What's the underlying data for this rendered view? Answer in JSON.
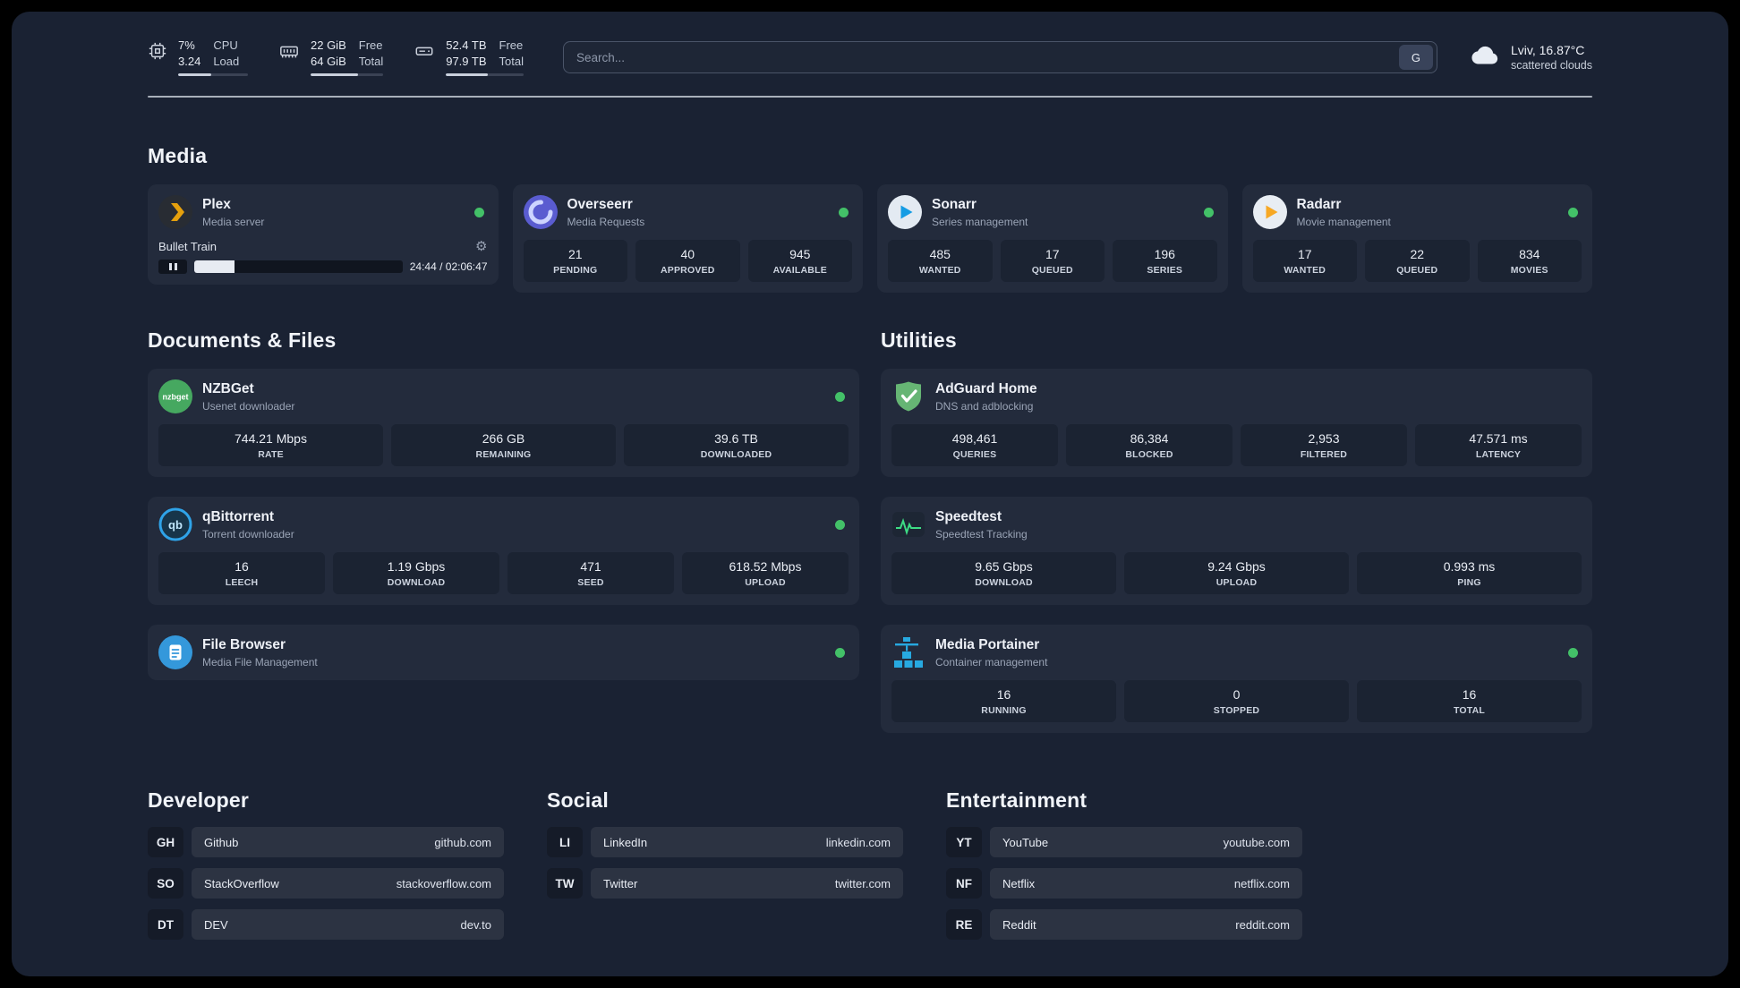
{
  "colors": {
    "background": "#1a2233",
    "card": "#232b3c",
    "stat_box": "#1b2332",
    "status_online": "#43c168",
    "plex_accent": "#e5a00d"
  },
  "topbar": {
    "cpu": {
      "icon": "cpu-icon",
      "value_top": "7%",
      "value_bottom": "3.24",
      "label_top": "CPU",
      "label_bottom": "Load",
      "bar_percent": 48
    },
    "ram": {
      "icon": "ram-icon",
      "value_top": "22 GiB",
      "value_bottom": "64 GiB",
      "label_top": "Free",
      "label_bottom": "Total",
      "bar_percent": 65
    },
    "disk": {
      "icon": "disk-icon",
      "value_top": "52.4 TB",
      "value_bottom": "97.9 TB",
      "label_top": "Free",
      "label_bottom": "Total",
      "bar_percent": 54
    },
    "search": {
      "placeholder": "Search...",
      "button_label": "G"
    },
    "weather": {
      "icon": "cloud-icon",
      "location": "Lviv, 16.87°C",
      "condition": "scattered clouds"
    }
  },
  "sections": {
    "media": "Media",
    "documents": "Documents & Files",
    "utilities": "Utilities",
    "developer": "Developer",
    "social": "Social",
    "entertainment": "Entertainment"
  },
  "apps": {
    "plex": {
      "name": "Plex",
      "subtitle": "Media server",
      "icon": "plex-icon",
      "online": true,
      "player": {
        "title": "Bullet Train",
        "time": "24:44 / 02:06:47",
        "progress_percent": 19.5
      }
    },
    "overseerr": {
      "name": "Overseerr",
      "subtitle": "Media Requests",
      "icon": "overseerr-icon",
      "online": true,
      "stats": [
        {
          "value": "21",
          "label": "PENDING"
        },
        {
          "value": "40",
          "label": "APPROVED"
        },
        {
          "value": "945",
          "label": "AVAILABLE"
        }
      ]
    },
    "sonarr": {
      "name": "Sonarr",
      "subtitle": "Series management",
      "icon": "sonarr-icon",
      "online": true,
      "stats": [
        {
          "value": "485",
          "label": "WANTED"
        },
        {
          "value": "17",
          "label": "QUEUED"
        },
        {
          "value": "196",
          "label": "SERIES"
        }
      ]
    },
    "radarr": {
      "name": "Radarr",
      "subtitle": "Movie management",
      "icon": "radarr-icon",
      "online": true,
      "stats": [
        {
          "value": "17",
          "label": "WANTED"
        },
        {
          "value": "22",
          "label": "QUEUED"
        },
        {
          "value": "834",
          "label": "MOVIES"
        }
      ]
    },
    "nzbget": {
      "name": "NZBGet",
      "subtitle": "Usenet downloader",
      "icon": "nzbget-icon",
      "online": true,
      "stats": [
        {
          "value": "744.21 Mbps",
          "label": "RATE"
        },
        {
          "value": "266 GB",
          "label": "REMAINING"
        },
        {
          "value": "39.6 TB",
          "label": "DOWNLOADED"
        }
      ]
    },
    "qbittorrent": {
      "name": "qBittorrent",
      "subtitle": "Torrent downloader",
      "icon": "qbittorrent-icon",
      "online": true,
      "stats": [
        {
          "value": "16",
          "label": "LEECH"
        },
        {
          "value": "1.19 Gbps",
          "label": "DOWNLOAD"
        },
        {
          "value": "471",
          "label": "SEED"
        },
        {
          "value": "618.52 Mbps",
          "label": "UPLOAD"
        }
      ]
    },
    "filebrowser": {
      "name": "File Browser",
      "subtitle": "Media File Management",
      "icon": "filebrowser-icon",
      "online": true
    },
    "adguard": {
      "name": "AdGuard Home",
      "subtitle": "DNS and adblocking",
      "icon": "adguard-icon",
      "stats": [
        {
          "value": "498,461",
          "label": "QUERIES"
        },
        {
          "value": "86,384",
          "label": "BLOCKED"
        },
        {
          "value": "2,953",
          "label": "FILTERED"
        },
        {
          "value": "47.571 ms",
          "label": "LATENCY"
        }
      ]
    },
    "speedtest": {
      "name": "Speedtest",
      "subtitle": "Speedtest Tracking",
      "icon": "speedtest-icon",
      "stats": [
        {
          "value": "9.65 Gbps",
          "label": "DOWNLOAD"
        },
        {
          "value": "9.24 Gbps",
          "label": "UPLOAD"
        },
        {
          "value": "0.993 ms",
          "label": "PING"
        }
      ]
    },
    "portainer": {
      "name": "Media Portainer",
      "subtitle": "Container management",
      "icon": "portainer-icon",
      "online": true,
      "stats": [
        {
          "value": "16",
          "label": "RUNNING"
        },
        {
          "value": "0",
          "label": "STOPPED"
        },
        {
          "value": "16",
          "label": "TOTAL"
        }
      ]
    }
  },
  "bookmarks": {
    "developer": [
      {
        "abbr": "GH",
        "name": "Github",
        "url": "github.com"
      },
      {
        "abbr": "SO",
        "name": "StackOverflow",
        "url": "stackoverflow.com"
      },
      {
        "abbr": "DT",
        "name": "DEV",
        "url": "dev.to"
      }
    ],
    "social": [
      {
        "abbr": "LI",
        "name": "LinkedIn",
        "url": "linkedin.com"
      },
      {
        "abbr": "TW",
        "name": "Twitter",
        "url": "twitter.com"
      }
    ],
    "entertainment": [
      {
        "abbr": "YT",
        "name": "YouTube",
        "url": "youtube.com"
      },
      {
        "abbr": "NF",
        "name": "Netflix",
        "url": "netflix.com"
      },
      {
        "abbr": "RE",
        "name": "Reddit",
        "url": "reddit.com"
      }
    ]
  }
}
